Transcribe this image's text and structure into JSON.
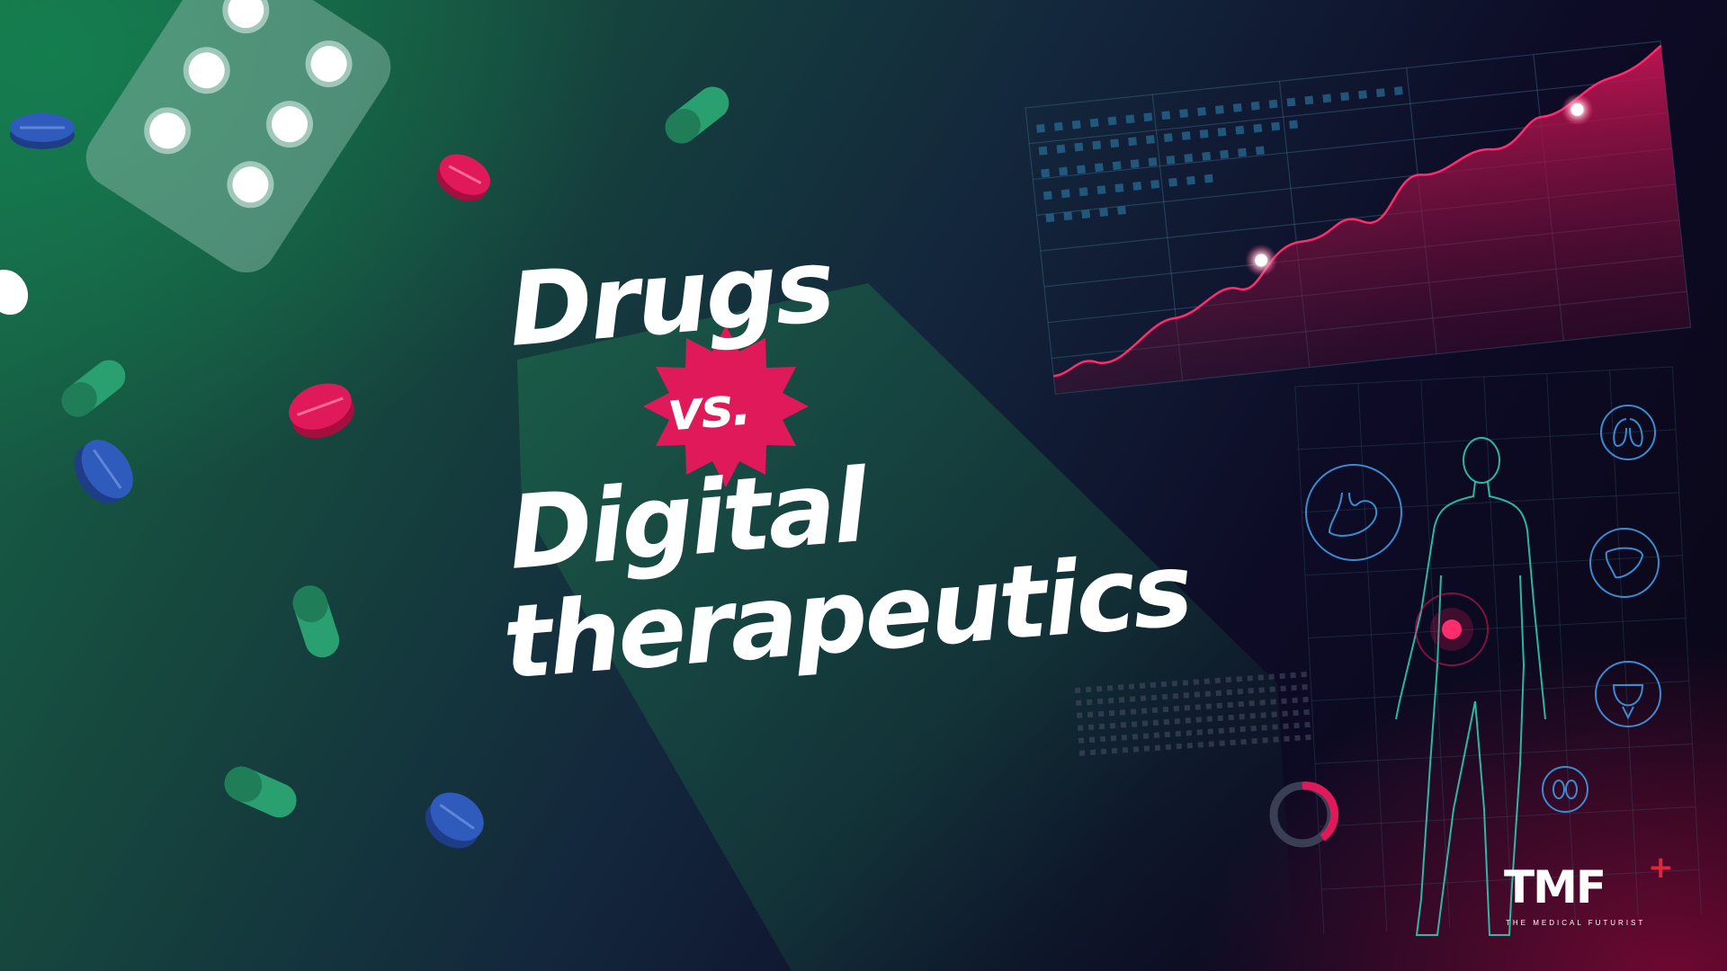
{
  "title": {
    "line1": "Drugs",
    "vs": "vs.",
    "line3": "Digital",
    "line4": "therapeutics"
  },
  "logo": {
    "mark": "TMF",
    "plus": "+",
    "subtitle": "THE MEDICAL FUTURIST"
  },
  "colors": {
    "accent_pink": "#e0195a",
    "pill_green": "#2a9f6f",
    "pill_blue": "#2a4fa8",
    "logo_red": "#e0263f"
  },
  "icons": [
    "blister-pack-icon",
    "pill-icon",
    "capsule-icon",
    "line-chart-icon",
    "human-body-icon",
    "stomach-icon",
    "lungs-icon",
    "liver-icon",
    "bladder-icon",
    "kidney-icon",
    "progress-ring-icon"
  ]
}
